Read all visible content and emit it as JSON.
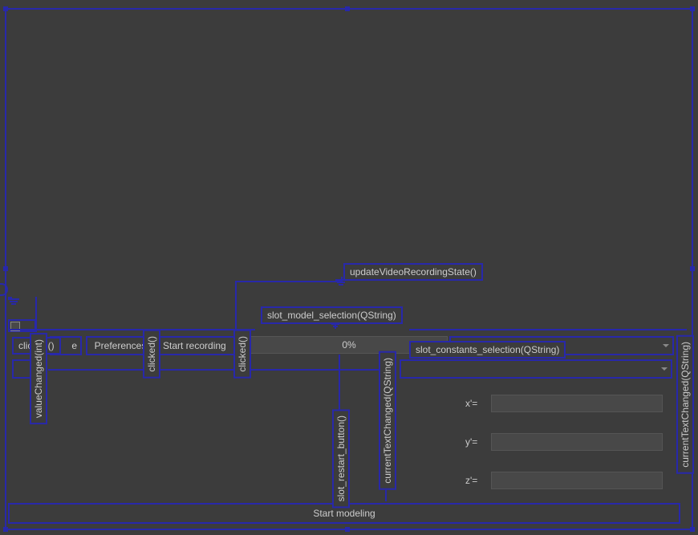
{
  "signals": {
    "updateVideoRecordingState": "updateVideoRecordingState()",
    "slot_model_selection": "slot_model_selection(QString)",
    "slot_constants_selection": "slot_constants_selection(QString)",
    "clicked1": "clicked()",
    "clicked2": "clicked()",
    "clicked3": "clicked()",
    "valueChanged": "valueChanged(int)",
    "slot_restart_button": "slot_restart_button()",
    "currentTextChanged1": "currentTextChanged(QString)",
    "currentTextChanged2": "currentTextChanged(QString)"
  },
  "buttons": {
    "preferences": "Preferences",
    "startRecording": "Start recording",
    "partial_e": "e",
    "startModeling": "Start modeling"
  },
  "progress": {
    "text": "0%"
  },
  "labels": {
    "x": "x'=",
    "y": "y'=",
    "z": "z'="
  }
}
